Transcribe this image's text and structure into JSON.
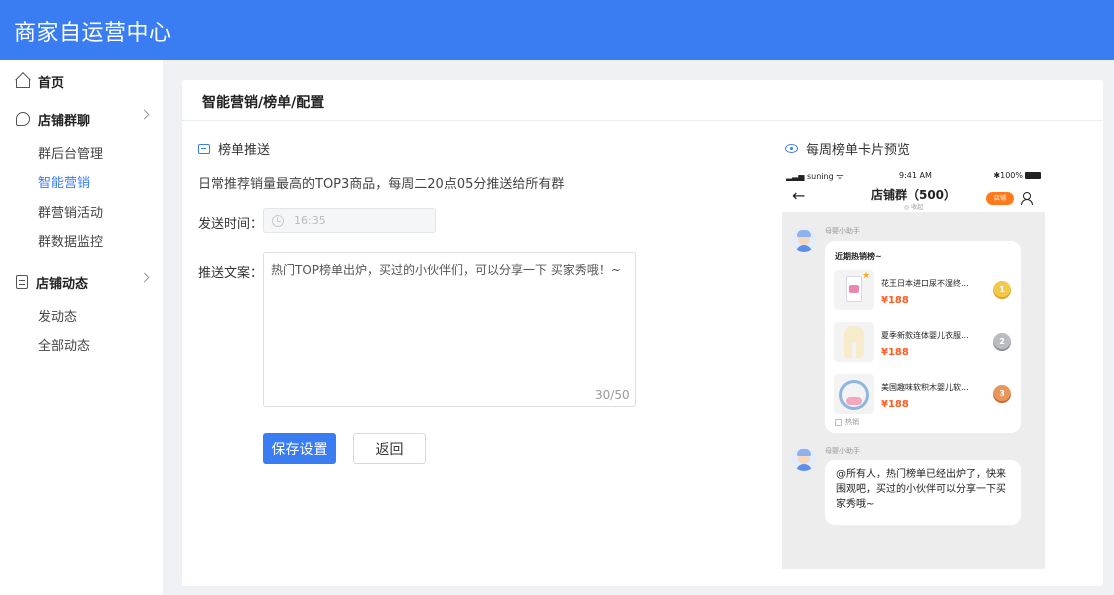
{
  "app": {
    "title": "商家自运营中心"
  },
  "sidebar": {
    "home": "首页",
    "group_chat": {
      "label": "店铺群聊",
      "items": [
        "群后台管理",
        "智能营销",
        "群营销活动",
        "群数据监控"
      ]
    },
    "shop_feed": {
      "label": "店铺动态",
      "items": [
        "发动态",
        "全部动态"
      ]
    },
    "active_item": "智能营销"
  },
  "page": {
    "breadcrumb": "智能营销/榜单/配置"
  },
  "form": {
    "section_title": "榜单推送",
    "description": "日常推荐销量最高的TOP3商品，每周二20点05分推送给所有群",
    "send_time": {
      "label": "发送时间：",
      "value": "16:35"
    },
    "message": {
      "label": "推送文案：",
      "value": "热门TOP榜单出炉，买过的小伙伴们，可以分享一下 买家秀哦！~",
      "counter": "30/50"
    },
    "save_label": "保存设置",
    "back_label": "返回"
  },
  "preview": {
    "title": "每周榜单卡片预览",
    "status_bar": {
      "carrier": "suning",
      "time": "9:41 AM",
      "battery": "100%"
    },
    "chat_title": "店铺群（500）",
    "chat_subtitle": "◎ 收起",
    "shop_badge": "店铺",
    "sender": "母婴小助手",
    "card": {
      "title": "近期热销榜~",
      "items": [
        {
          "name": "花王日本进口尿不湿终...",
          "price": "¥188",
          "rank": "1"
        },
        {
          "name": "夏季新款连体婴儿衣服...",
          "price": "¥188",
          "rank": "2"
        },
        {
          "name": "美国趣味软积木婴儿软...",
          "price": "¥188",
          "rank": "3"
        }
      ],
      "tag": "热销"
    },
    "second_sender": "母婴小助手",
    "message": "@所有人，热门榜单已经出炉了，快来围观吧，买过的小伙伴可以分享一下买家秀哦~"
  }
}
